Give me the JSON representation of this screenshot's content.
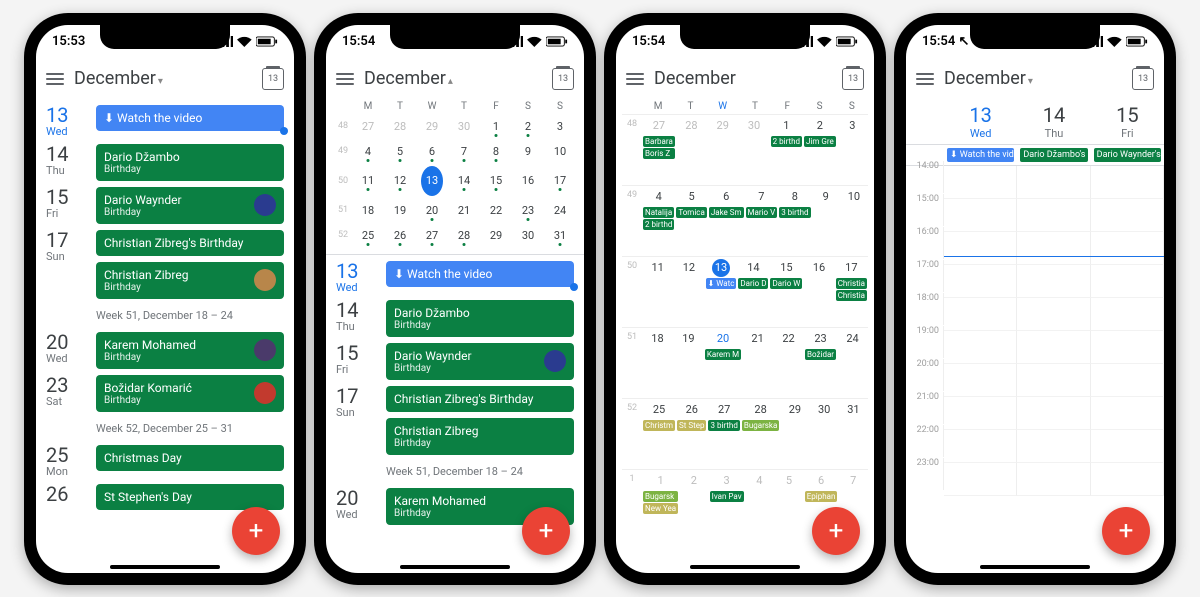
{
  "colors": {
    "accent": "#1a73e8",
    "green": "#0b8043",
    "blue": "#4285f4",
    "fab": "#ea4335"
  },
  "phones": [
    {
      "time": "15:53",
      "month": "December",
      "chev": "▾",
      "today_day": "13"
    },
    {
      "time": "15:54",
      "month": "December",
      "chev": "▴",
      "today_day": "13"
    },
    {
      "time": "15:54",
      "month": "December",
      "chev": "",
      "today_day": "13"
    },
    {
      "time": "15:54 ↖",
      "month": "December",
      "chev": "▾",
      "today_day": "13"
    }
  ],
  "schedule": [
    {
      "num": "13",
      "name": "Wed",
      "active": true,
      "events": [
        {
          "style": "blue",
          "title": "⬇ Watch the video",
          "now": true
        }
      ]
    },
    {
      "num": "14",
      "name": "Thu",
      "events": [
        {
          "style": "green",
          "title": "Dario Džambo",
          "sub": "Birthday"
        }
      ]
    },
    {
      "num": "15",
      "name": "Fri",
      "events": [
        {
          "style": "green",
          "title": "Dario Waynder",
          "sub": "Birthday",
          "avatar": "#2a3b8f"
        }
      ]
    },
    {
      "num": "17",
      "name": "Sun",
      "events": [
        {
          "style": "green",
          "title": "Christian Zibreg's Birthday"
        },
        {
          "style": "green",
          "title": "Christian Zibreg",
          "sub": "Birthday",
          "avatar": "#b8864a"
        }
      ]
    },
    {
      "header": "Week 51, December 18 – 24"
    },
    {
      "num": "20",
      "name": "Wed",
      "events": [
        {
          "style": "green",
          "title": "Karem Mohamed",
          "sub": "Birthday",
          "avatar": "#4a3a6a"
        }
      ]
    },
    {
      "num": "23",
      "name": "Sat",
      "events": [
        {
          "style": "green",
          "title": "Božidar Komarić",
          "sub": "Birthday",
          "avatar": "#c23a2e"
        }
      ]
    },
    {
      "header": "Week 52, December 25 – 31"
    },
    {
      "num": "25",
      "name": "Mon",
      "events": [
        {
          "style": "green",
          "title": "Christmas Day"
        }
      ]
    },
    {
      "num": "26",
      "name": "",
      "events": [
        {
          "style": "green",
          "title": "St Stephen's Day"
        }
      ]
    }
  ],
  "mini_month": {
    "dow": [
      "M",
      "T",
      "W",
      "T",
      "F",
      "S",
      "S"
    ],
    "rows": [
      {
        "wn": "48",
        "days": [
          {
            "n": "27",
            "o": true
          },
          {
            "n": "28",
            "o": true
          },
          {
            "n": "29",
            "o": true
          },
          {
            "n": "30",
            "o": true
          },
          {
            "n": "1",
            "d": true
          },
          {
            "n": "2",
            "d": true
          },
          {
            "n": "3"
          }
        ]
      },
      {
        "wn": "49",
        "days": [
          {
            "n": "4",
            "d": true
          },
          {
            "n": "5",
            "d": true
          },
          {
            "n": "6",
            "d": true
          },
          {
            "n": "7",
            "d": true
          },
          {
            "n": "8",
            "d": true
          },
          {
            "n": "9"
          },
          {
            "n": "10"
          }
        ]
      },
      {
        "wn": "50",
        "days": [
          {
            "n": "11",
            "d": true
          },
          {
            "n": "12",
            "d": true
          },
          {
            "n": "13",
            "sel": true
          },
          {
            "n": "14",
            "d": true
          },
          {
            "n": "15",
            "d": true
          },
          {
            "n": "16"
          },
          {
            "n": "17",
            "d": true
          }
        ]
      },
      {
        "wn": "51",
        "days": [
          {
            "n": "18"
          },
          {
            "n": "19"
          },
          {
            "n": "20",
            "d": true
          },
          {
            "n": "21"
          },
          {
            "n": "22"
          },
          {
            "n": "23",
            "d": true
          },
          {
            "n": "24"
          }
        ]
      },
      {
        "wn": "52",
        "days": [
          {
            "n": "25",
            "d": true
          },
          {
            "n": "26",
            "d": true
          },
          {
            "n": "27",
            "d": true
          },
          {
            "n": "28",
            "d": true
          },
          {
            "n": "29"
          },
          {
            "n": "30"
          },
          {
            "n": "31",
            "d": true
          }
        ]
      }
    ]
  },
  "schedule2": [
    {
      "num": "13",
      "name": "Wed",
      "active": true,
      "events": [
        {
          "style": "blue",
          "title": "⬇ Watch the video",
          "now": true
        }
      ]
    },
    {
      "num": "14",
      "name": "Thu",
      "events": [
        {
          "style": "green",
          "title": "Dario Džambo",
          "sub": "Birthday"
        }
      ]
    },
    {
      "num": "15",
      "name": "Fri",
      "events": [
        {
          "style": "green",
          "title": "Dario Waynder",
          "sub": "Birthday",
          "avatar": "#2a3b8f"
        }
      ]
    },
    {
      "num": "17",
      "name": "Sun",
      "events": [
        {
          "style": "green",
          "title": "Christian Zibreg's Birthday"
        },
        {
          "style": "green",
          "title": "Christian Zibreg",
          "sub": "Birthday"
        }
      ]
    },
    {
      "header": "Week 51, December 18 – 24"
    },
    {
      "num": "20",
      "name": "Wed",
      "events": [
        {
          "style": "green",
          "title": "Karem Mohamed",
          "sub": "Birthday"
        }
      ]
    }
  ],
  "month": {
    "dow": [
      "M",
      "T",
      "W",
      "T",
      "F",
      "S",
      "S"
    ],
    "weeks": [
      {
        "wn": "48",
        "days": [
          {
            "n": "27",
            "o": true,
            "ev": [
              {
                "t": "Barbara"
              },
              {
                "t": "Boris Z"
              }
            ]
          },
          {
            "n": "28",
            "o": true
          },
          {
            "n": "29",
            "o": true
          },
          {
            "n": "30",
            "o": true
          },
          {
            "n": "1",
            "ev": [
              {
                "t": "2 birthd"
              }
            ]
          },
          {
            "n": "2",
            "ev": [
              {
                "t": "Jim Gre"
              }
            ]
          },
          {
            "n": "3"
          }
        ]
      },
      {
        "wn": "49",
        "days": [
          {
            "n": "4",
            "ev": [
              {
                "t": "Natalija"
              },
              {
                "t": "2 birthd"
              }
            ]
          },
          {
            "n": "5",
            "ev": [
              {
                "t": "Tomica"
              }
            ]
          },
          {
            "n": "6",
            "ev": [
              {
                "t": "Jake Sm"
              }
            ]
          },
          {
            "n": "7",
            "ev": [
              {
                "t": "Mario V"
              }
            ]
          },
          {
            "n": "8",
            "ev": [
              {
                "t": "3 birthd"
              }
            ]
          },
          {
            "n": "9"
          },
          {
            "n": "10"
          }
        ]
      },
      {
        "wn": "50",
        "days": [
          {
            "n": "11"
          },
          {
            "n": "12"
          },
          {
            "n": "13",
            "sel": true,
            "ev": [
              {
                "t": "⬇ Watc",
                "c": "blue"
              }
            ]
          },
          {
            "n": "14",
            "ev": [
              {
                "t": "Dario D"
              }
            ]
          },
          {
            "n": "15",
            "ev": [
              {
                "t": "Dario W"
              }
            ]
          },
          {
            "n": "16"
          },
          {
            "n": "17",
            "ev": [
              {
                "t": "Christia"
              },
              {
                "t": "Christia"
              }
            ]
          }
        ]
      },
      {
        "wn": "51",
        "days": [
          {
            "n": "18"
          },
          {
            "n": "19"
          },
          {
            "n": "20",
            "wed": true,
            "ev": [
              {
                "t": "Karem M"
              }
            ]
          },
          {
            "n": "21"
          },
          {
            "n": "22"
          },
          {
            "n": "23",
            "ev": [
              {
                "t": "Božidar"
              }
            ]
          },
          {
            "n": "24"
          }
        ]
      },
      {
        "wn": "52",
        "days": [
          {
            "n": "25",
            "ev": [
              {
                "t": "Christm",
                "c": "olive"
              }
            ]
          },
          {
            "n": "26",
            "ev": [
              {
                "t": "St Step",
                "c": "olive"
              }
            ]
          },
          {
            "n": "27",
            "ev": [
              {
                "t": "3 birthd"
              }
            ]
          },
          {
            "n": "28",
            "ev": [
              {
                "t": "Bugarska",
                "c": "lgreen"
              }
            ]
          },
          {
            "n": "29"
          },
          {
            "n": "30"
          },
          {
            "n": "31"
          }
        ]
      },
      {
        "wn": "1",
        "days": [
          {
            "n": "1",
            "o": true,
            "ev": [
              {
                "t": "Bugarsk",
                "c": "lgreen"
              },
              {
                "t": "New Yea",
                "c": "olive"
              }
            ]
          },
          {
            "n": "2",
            "o": true
          },
          {
            "n": "3",
            "o": true,
            "ev": [
              {
                "t": "Ivan Pav"
              }
            ]
          },
          {
            "n": "4",
            "o": true
          },
          {
            "n": "5",
            "o": true
          },
          {
            "n": "6",
            "o": true,
            "ev": [
              {
                "t": "Epiphan",
                "c": "olive"
              }
            ]
          },
          {
            "n": "7",
            "o": true
          }
        ]
      }
    ]
  },
  "three_day": {
    "days": [
      {
        "n": "13",
        "w": "Wed",
        "active": true
      },
      {
        "n": "14",
        "w": "Thu"
      },
      {
        "n": "15",
        "w": "Fri"
      }
    ],
    "allday": [
      {
        "t": "⬇ Watch the vide",
        "c": "blue"
      },
      {
        "t": "Dario Džambo's b"
      },
      {
        "t": "Dario Waynder's"
      }
    ],
    "hours": [
      "14:00",
      "15:00",
      "16:00",
      "17:00",
      "18:00",
      "19:00",
      "20:00",
      "21:00",
      "22:00",
      "23:00"
    ],
    "now_after": "15:00"
  }
}
